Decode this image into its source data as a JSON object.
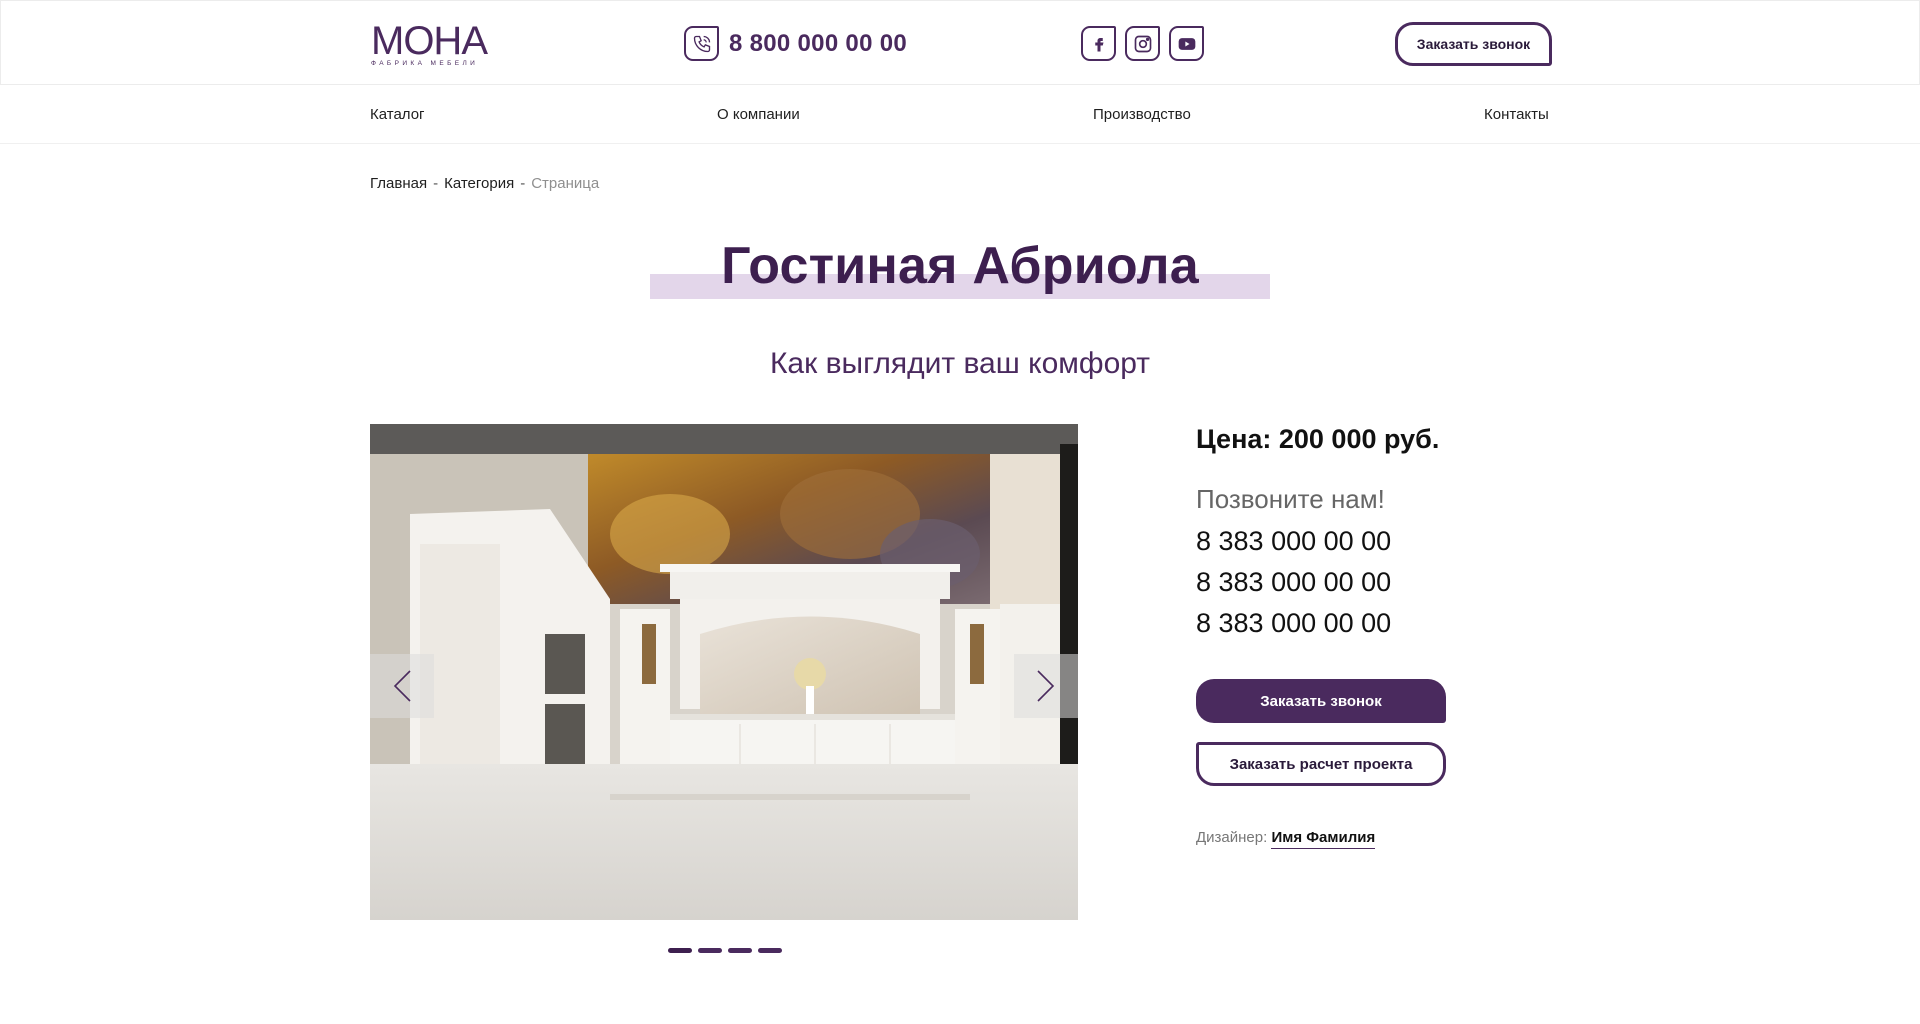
{
  "header": {
    "logo_text": "МОНА",
    "logo_sub": "ФАБРИКА МЕБЕЛИ",
    "phone": "8 800 000 00 00",
    "social_icons": [
      "facebook-icon",
      "instagram-icon",
      "youtube-icon"
    ],
    "callback_label": "Заказать звонок"
  },
  "nav": {
    "items": [
      {
        "label": "Каталог"
      },
      {
        "label": "О компании"
      },
      {
        "label": "Производство"
      },
      {
        "label": "Контакты"
      }
    ]
  },
  "breadcrumb": {
    "home": "Главная",
    "category": "Категория",
    "current": "Страница",
    "separator": "-"
  },
  "page": {
    "title": "Гостиная Абриола",
    "subtitle": "Как выглядит ваш комфорт"
  },
  "gallery": {
    "slides_count": 4,
    "active_slide": 1
  },
  "side": {
    "price": "Цена: 200 000 руб.",
    "call_label": "Позвоните нам!",
    "phones": [
      "8 383 000 00 00",
      "8 383 000 00 00",
      "8 383 000 00 00"
    ],
    "callback_button": "Заказать звонок",
    "estimate_button": "Заказать расчет проекта",
    "designer_label": "Дизайнер:",
    "designer_name": "Имя Фамилия"
  },
  "colors": {
    "brand": "#4a2a5e",
    "title_highlight": "#e3d6ea"
  }
}
